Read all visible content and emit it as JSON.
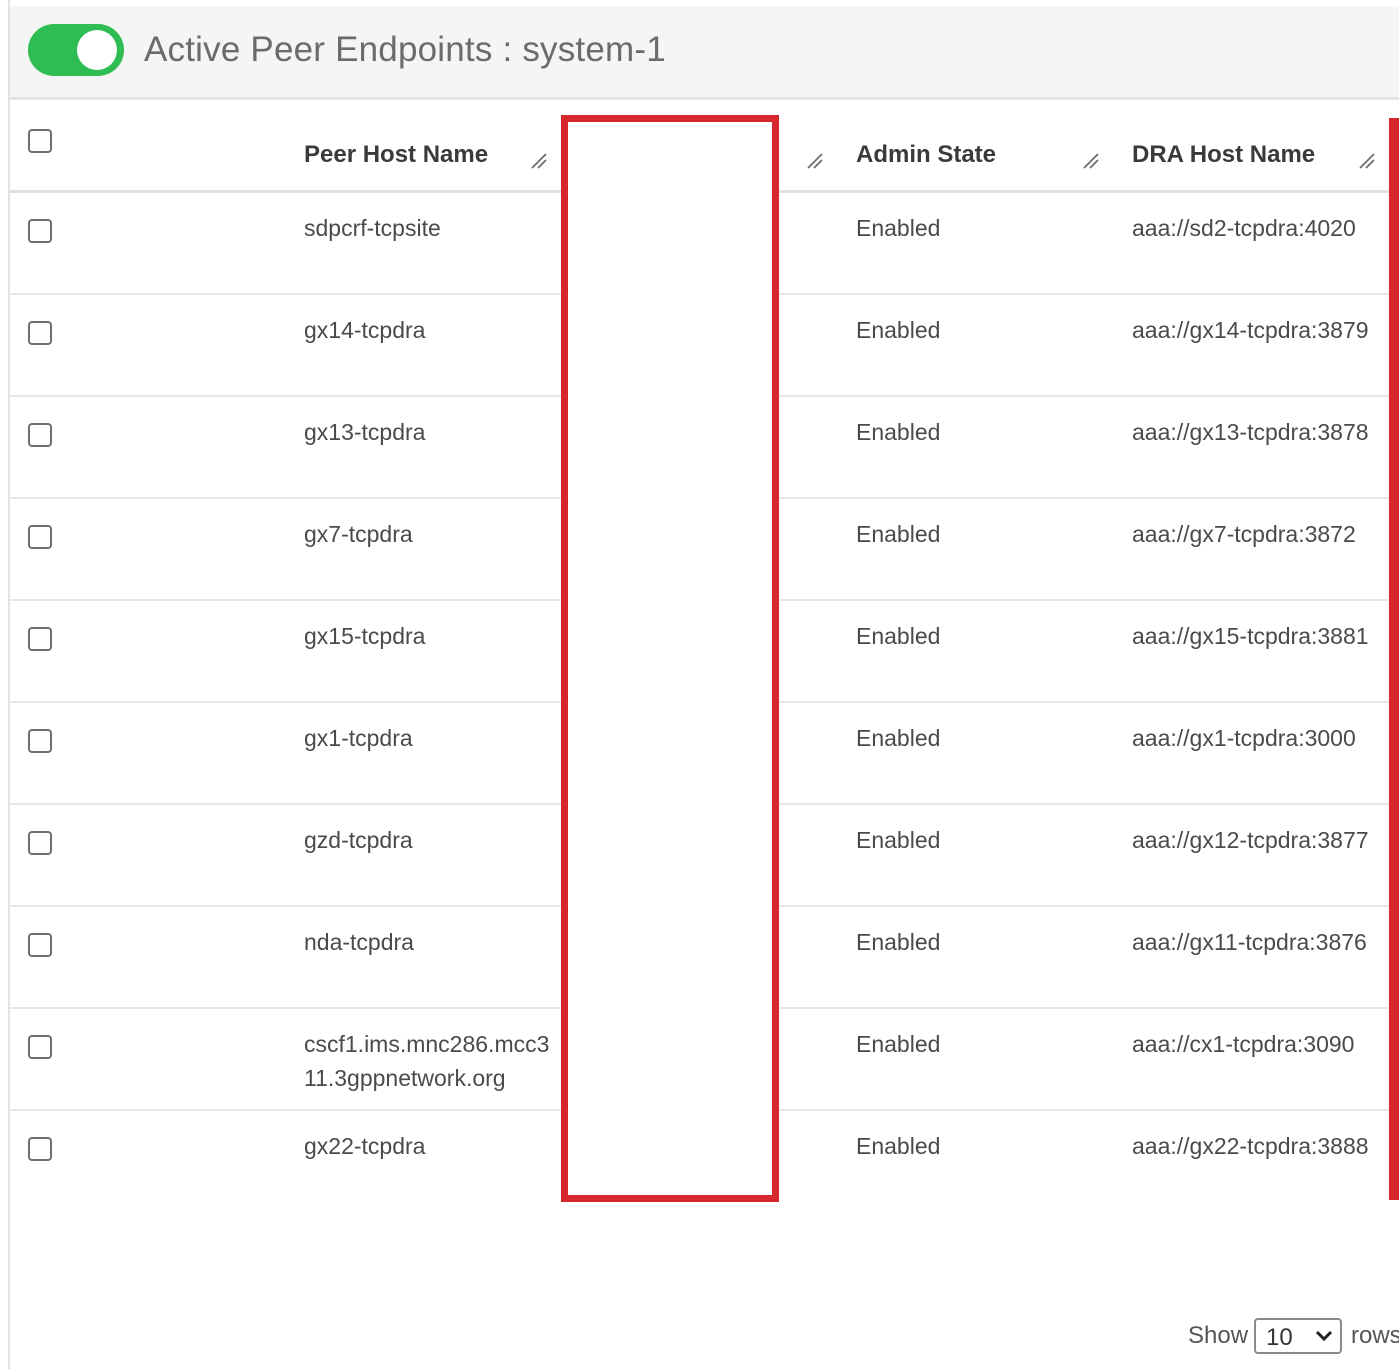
{
  "header": {
    "toggle_state": "on",
    "title": "Active Peer Endpoints : system-1",
    "accent_color": "#2ebd52"
  },
  "table": {
    "columns": [
      "Peer Host Name",
      "",
      "Admin State",
      "DRA Host Name"
    ],
    "rows": [
      {
        "peer_host": "sdpcrf-tcpsite",
        "admin_state": "Enabled",
        "dra_host": "aaa://sd2-tcpdra:4020"
      },
      {
        "peer_host": "gx14-tcpdra",
        "admin_state": "Enabled",
        "dra_host": "aaa://gx14-tcpdra:3879"
      },
      {
        "peer_host": "gx13-tcpdra",
        "admin_state": "Enabled",
        "dra_host": "aaa://gx13-tcpdra:3878"
      },
      {
        "peer_host": "gx7-tcpdra",
        "admin_state": "Enabled",
        "dra_host": "aaa://gx7-tcpdra:3872"
      },
      {
        "peer_host": "gx15-tcpdra",
        "admin_state": "Enabled",
        "dra_host": "aaa://gx15-tcpdra:3881"
      },
      {
        "peer_host": "gx1-tcpdra",
        "admin_state": "Enabled",
        "dra_host": "aaa://gx1-tcpdra:3000"
      },
      {
        "peer_host": "gzd-tcpdra",
        "admin_state": "Enabled",
        "dra_host": "aaa://gx12-tcpdra:3877"
      },
      {
        "peer_host": "nda-tcpdra",
        "admin_state": "Enabled",
        "dra_host": "aaa://gx11-tcpdra:3876"
      },
      {
        "peer_host": "cscf1.ims.mnc286.mcc311.3gppnetwork.org",
        "admin_state": "Enabled",
        "dra_host": "aaa://cx1-tcpdra:3090"
      },
      {
        "peer_host": "gx22-tcpdra",
        "admin_state": "Enabled",
        "dra_host": "aaa://gx22-tcpdra:3888"
      }
    ]
  },
  "highlight_color": "#d7272d",
  "footer": {
    "show_label": "Show",
    "page_size": "10",
    "rows_label": "rows"
  }
}
